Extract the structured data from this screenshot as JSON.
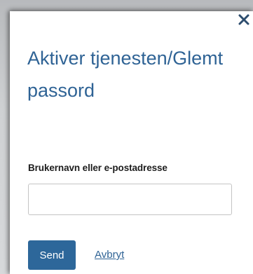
{
  "dialog": {
    "title": "Aktiver tjenesten/Glemt passord",
    "close_icon": "close-icon",
    "username_label": "Brukernavn eller e-postadresse",
    "username_value": "",
    "username_placeholder": "",
    "send_label": "Send",
    "cancel_label": "Avbryt"
  },
  "colors": {
    "title": "#2f6395",
    "button_bg": "#2d679a",
    "link": "#2f6395",
    "close_icon": "#2d4d6e"
  }
}
